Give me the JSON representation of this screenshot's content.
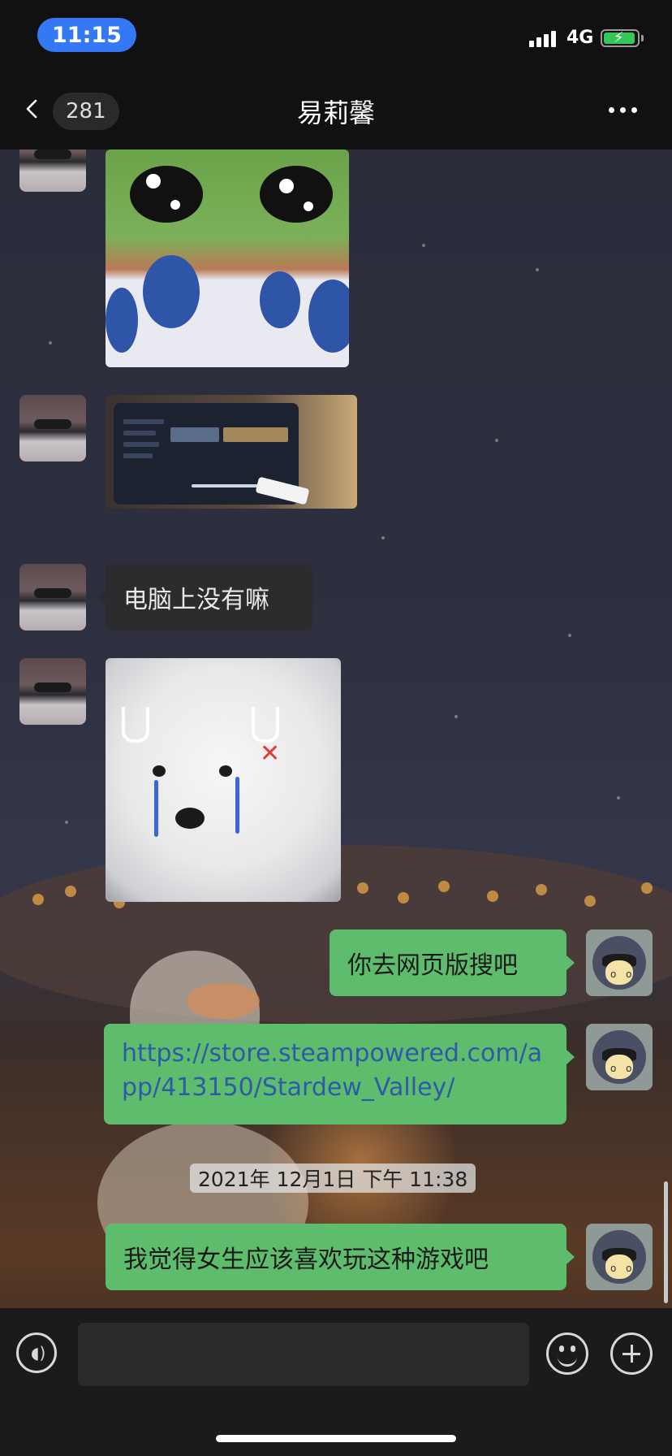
{
  "status_bar": {
    "time": "11:15",
    "network": "4G",
    "battery_charging": true,
    "battery_color": "#34c759",
    "signal_bars": 4
  },
  "nav": {
    "back_icon": "chevron-left-icon",
    "unread_count": "281",
    "title": "易莉馨",
    "more_icon": "more-dots-icon"
  },
  "messages": [
    {
      "side": "left",
      "type": "image",
      "content": "pepe meme image"
    },
    {
      "side": "left",
      "type": "image",
      "content": "tablet photo"
    },
    {
      "side": "left",
      "type": "text",
      "text": "电脑上没有嘛"
    },
    {
      "side": "left",
      "type": "image",
      "content": "crying samoyed sticker"
    },
    {
      "side": "right",
      "type": "text",
      "text": "你去网页版搜吧"
    },
    {
      "side": "right",
      "type": "link",
      "text": "https://store.steampowered.com/app/413150/Stardew_Valley/"
    },
    {
      "side": "right",
      "type": "text",
      "text": "我觉得女生应该喜欢玩这种游戏吧"
    }
  ],
  "timestamp": "2021年 12月1日 下午 11:38",
  "input_bar": {
    "voice_icon": "voice-icon",
    "placeholder": "",
    "emoji_icon": "emoji-icon",
    "plus_icon": "plus-icon"
  },
  "colors": {
    "outgoing_bubble": "#5ebd6c",
    "incoming_bubble": "#2c2c2e",
    "accent_time_pill": "#3478f6",
    "link": "#2f5aa8"
  }
}
